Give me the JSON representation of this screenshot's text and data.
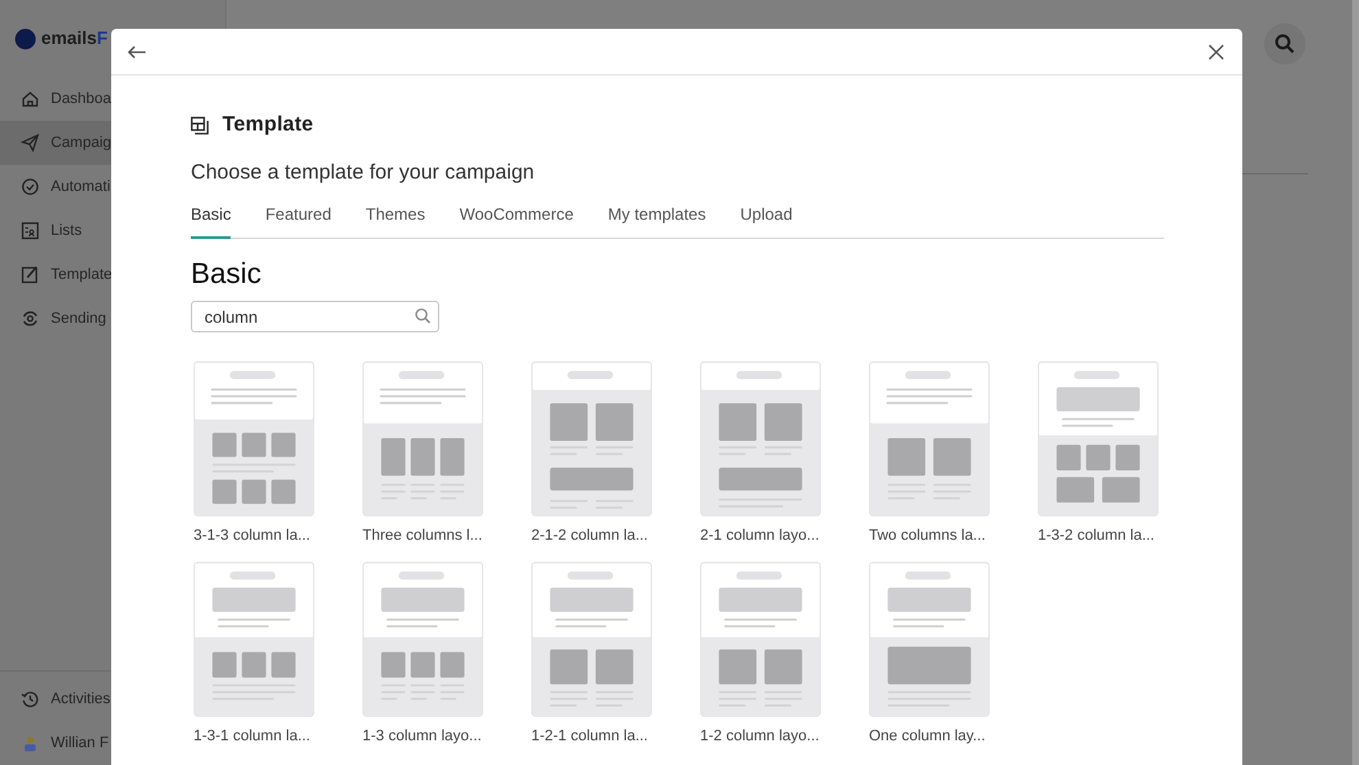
{
  "app": {
    "logo": {
      "text": "emails",
      "accent": "F"
    },
    "sidebar": {
      "items": [
        {
          "label": "Dashboa",
          "selected": false
        },
        {
          "label": "Campaig",
          "selected": true
        },
        {
          "label": "Automati",
          "selected": false
        },
        {
          "label": "Lists",
          "selected": false
        },
        {
          "label": "Template",
          "selected": false
        },
        {
          "label": "Sending",
          "selected": false
        }
      ],
      "footer": [
        {
          "label": "Activities"
        },
        {
          "label": "Willian F"
        }
      ]
    }
  },
  "modal": {
    "title": "Template",
    "subtitle": "Choose a template for your campaign",
    "tabs": [
      {
        "label": "Basic",
        "selected": true
      },
      {
        "label": "Featured",
        "selected": false
      },
      {
        "label": "Themes",
        "selected": false
      },
      {
        "label": "WooCommerce",
        "selected": false
      },
      {
        "label": "My templates",
        "selected": false
      },
      {
        "label": "Upload",
        "selected": false
      }
    ],
    "section_title": "Basic",
    "search": {
      "value": "column"
    },
    "templates": [
      {
        "name": "3-1-3 column la...",
        "kind": "t313"
      },
      {
        "name": "Three columns l...",
        "kind": "three"
      },
      {
        "name": "2-1-2 column la...",
        "kind": "t212"
      },
      {
        "name": "2-1 column layo...",
        "kind": "t21"
      },
      {
        "name": "Two columns la...",
        "kind": "two"
      },
      {
        "name": "1-3-2 column la...",
        "kind": "t132"
      },
      {
        "name": "1-3-1 column la...",
        "kind": "t131"
      },
      {
        "name": "1-3 column layo...",
        "kind": "t13"
      },
      {
        "name": "1-2-1 column la...",
        "kind": "t121"
      },
      {
        "name": "1-2 column layo...",
        "kind": "t12"
      },
      {
        "name": "One column lay...",
        "kind": "one"
      }
    ]
  }
}
